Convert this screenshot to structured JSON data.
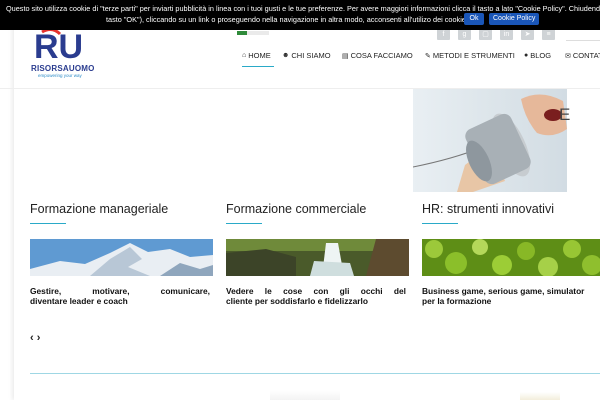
{
  "cookie_banner": {
    "line1": "Questo sito utilizza cookie di \"terze parti\" per inviarti pubblicità in linea con i tuoi gusti e le tue preferenze. Per avere maggiori informazioni clicca il tasto a lato \"Cookie Policy\". Chiudendo il ba",
    "line2": "tasto \"OK\"), cliccando su un link o proseguendo nella navigazione in altra modo, acconsenti all'utilizo dei cookie.",
    "ok_label": "Ok",
    "policy_label": "Cookie Policy"
  },
  "logo": {
    "mark": "RU",
    "name": "RISORSAUOMO",
    "tagline": "empowering your way"
  },
  "nav": {
    "items": [
      {
        "label": "HOME",
        "icon": "home-icon"
      },
      {
        "label": "CHI SIAMO",
        "icon": "group-icon"
      },
      {
        "label": "COSA FACCIAMO",
        "icon": "book-icon"
      },
      {
        "label": "METODI E STRUMENTI",
        "icon": "pencil-icon"
      },
      {
        "label": "BLOG",
        "icon": "comment-icon"
      },
      {
        "label": "CONTAT",
        "icon": "envelope-icon"
      }
    ]
  },
  "hero": {
    "overflow_letter": "E"
  },
  "columns": [
    {
      "title": "Formazione manageriale",
      "desc_line1": "Gestire, motivare, comunicare,",
      "desc_line2": "diventare leader e coach"
    },
    {
      "title": "Formazione commerciale",
      "desc_line1": "Vedere le cose con gli occhi del",
      "desc_line2": "cliente per soddisfarlo e fidelizzarlo"
    },
    {
      "title": "HR: strumenti innovativi",
      "desc_line1": "Business game, serious game, simulator",
      "desc_line2": "per la formazione"
    }
  ],
  "slider": {
    "prev": "‹",
    "next": "›"
  },
  "colors": {
    "accent": "#2aaac8",
    "brand": "#2a3c8f",
    "cookie_button": "#1a56b8"
  }
}
